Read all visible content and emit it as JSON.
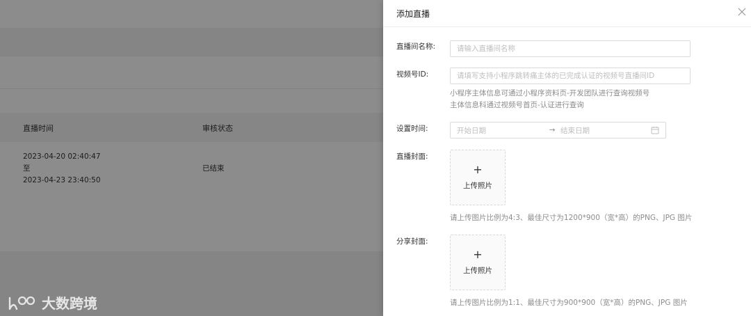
{
  "background": {
    "table": {
      "columns": [
        "直播时间",
        "审核状态"
      ],
      "rows": [
        {
          "time_start": "2023-04-20 02:40:47",
          "time_sep": "至",
          "time_end": "2023-04-23 23:40:50",
          "status": "已结束"
        }
      ]
    },
    "watermark_text": "大数跨境"
  },
  "drawer": {
    "title": "添加直播",
    "close_icon": "close-icon",
    "fields": {
      "name": {
        "label": "直播间名称:",
        "placeholder": "请输入直播间名称"
      },
      "video_id": {
        "label": "视频号ID:",
        "placeholder": "请填写支持小程序跳转痛主体的已完成认证的视频号直播间ID",
        "hint_line1": "小程序主体信息可通过小程序资料页-开发团队进行查询视频号",
        "hint_line2": "主体信息科通过视频号首页-认证进行查询"
      },
      "time": {
        "label": "设置时间:",
        "start_placeholder": "开始日期",
        "separator": "→",
        "end_placeholder": "结束日期",
        "icon": "calendar-icon"
      },
      "cover": {
        "label": "直播封面:",
        "plus": "+",
        "upload_text": "上传照片",
        "hint": "请上传图片比例为4:3、最佳尺寸为1200*900（宽*高）的PNG、JPG 图片"
      },
      "share": {
        "label": "分享封面:",
        "plus": "+",
        "upload_text": "上传照片",
        "hint": "请上传图片比例为1:1、最佳尺寸为900*900（宽*高）的PNG、JPG 图片"
      }
    }
  }
}
